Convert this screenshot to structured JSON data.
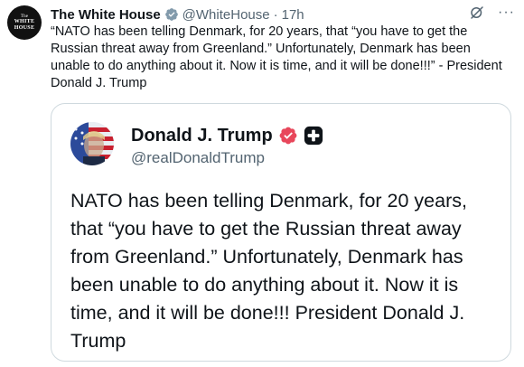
{
  "tweet": {
    "avatar_text": [
      "The",
      "WHITE",
      "HOUSE"
    ],
    "author_name": "The White House",
    "author_handle": "@WhiteHouse",
    "separator": "·",
    "timestamp": "17h",
    "text": "“NATO has been telling Denmark, for 20 years, that “you have to get the Russian threat away from Greenland.” Unfortunately, Denmark has been unable to do anything about it. Now it is time, and it will be done!!!” - President Donald J. Trump",
    "icons": {
      "verified": "verified-gray-badge-icon",
      "grok": "grok-icon",
      "more": "more-options-icon"
    },
    "more_glyph": "···"
  },
  "quote": {
    "author_name": "Donald J. Trump",
    "author_handle": "@realDonaldTrump",
    "text": "NATO has been telling Denmark, for 20 years, that “you have to get the Russian threat away from Greenland.” Unfortunately, Denmark has been unable to do anything about it. Now it is time, and it will be done!!! President Donald J. Trump",
    "icons": {
      "verified": "verified-badge-icon",
      "plus": "plus-icon"
    }
  },
  "colors": {
    "text_primary": "#0f1419",
    "text_secondary": "#536471",
    "border": "#cfd9de",
    "truth_badge": "#e8475b"
  }
}
